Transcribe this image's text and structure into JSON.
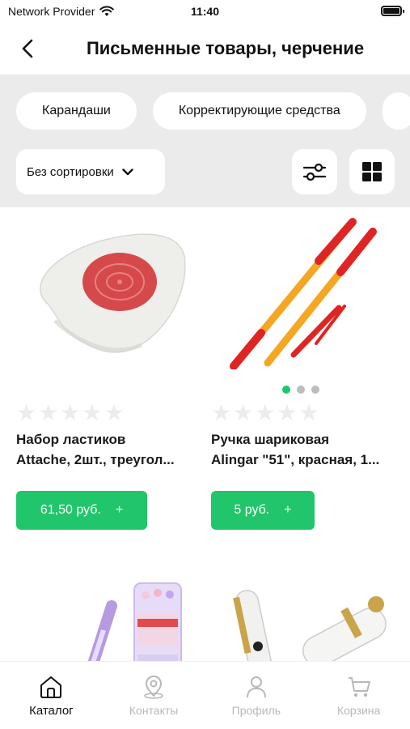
{
  "status_bar": {
    "carrier": "Network Provider",
    "time": "11:40",
    "icons": [
      "wifi-icon",
      "battery-icon"
    ]
  },
  "header": {
    "title": "Письменные товары, черчение",
    "back_icon": "chevron-left-icon"
  },
  "filters": {
    "chips": [
      {
        "label": "Карандаши"
      },
      {
        "label": "Корректирующие средства"
      }
    ],
    "sort_label": "Без сортировки",
    "sort_icon": "chevron-down-icon",
    "filter_icon": "sliders-icon",
    "view_icon": "grid-icon"
  },
  "products": [
    {
      "name_line1": "Набор ластиков",
      "name_line2": "Attache, 2шт., треугол...",
      "price": "61,50 руб.",
      "add": "+",
      "rating": 0,
      "image": "eraser-image"
    },
    {
      "name_line1": "Ручка шариковая",
      "name_line2": "Alingar \"51\", красная, 1...",
      "price": "5 руб.",
      "add": "+",
      "rating": 0,
      "image": "pens-image",
      "gallery_dots": 3,
      "gallery_active": 0
    },
    {
      "image": "pencil-set-image"
    },
    {
      "image": "fountain-pen-image"
    }
  ],
  "tabbar": [
    {
      "label": "Каталог",
      "icon": "home-icon",
      "active": true
    },
    {
      "label": "Контакты",
      "icon": "location-pin-icon",
      "active": false
    },
    {
      "label": "Профиль",
      "icon": "person-icon",
      "active": false
    },
    {
      "label": "Корзина",
      "icon": "cart-icon",
      "active": false
    }
  ],
  "colors": {
    "accent": "#21c56b",
    "panel_bg": "#ebebeb",
    "inactive_tab": "#b8b8b8"
  }
}
